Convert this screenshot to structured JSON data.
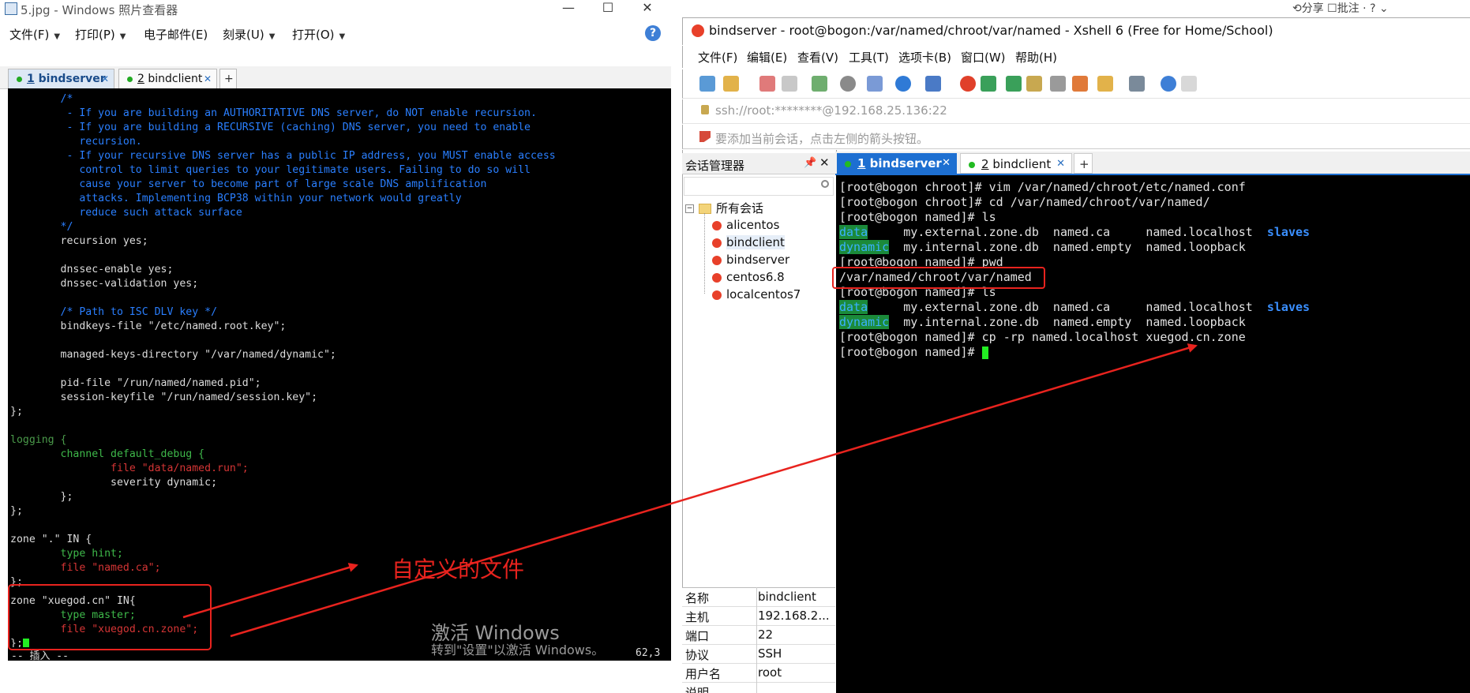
{
  "left_window": {
    "title": "5.jpg - Windows 照片查看器",
    "controls": [
      "—",
      "☐",
      "✕"
    ],
    "menu": [
      {
        "label": "文件(F)",
        "has_dropdown": true
      },
      {
        "label": "打印(P)",
        "has_dropdown": true
      },
      {
        "label": "电子邮件(E)",
        "has_dropdown": false
      },
      {
        "label": "刻录(U)",
        "has_dropdown": true
      },
      {
        "label": "打开(O)",
        "has_dropdown": true
      }
    ],
    "help_label": "?",
    "tabs": [
      {
        "num": "1",
        "name": "bindserver",
        "close": "✕"
      },
      {
        "num": "2",
        "name": "bindclient",
        "close": "✕"
      }
    ],
    "new_tab": "+",
    "terminal": {
      "lines": [
        "        /*",
        "         - If you are building an AUTHORITATIVE DNS server, do NOT enable recursion.",
        "         - If you are building a RECURSIVE (caching) DNS server, you need to enable",
        "           recursion.",
        "         - If your recursive DNS server has a public IP address, you MUST enable access",
        "           control to limit queries to your legitimate users. Failing to do so will",
        "           cause your server to become part of large scale DNS amplification",
        "           attacks. Implementing BCP38 within your network would greatly",
        "           reduce such attack surface",
        "        */",
        "        recursion yes;",
        "",
        "        dnssec-enable yes;",
        "        dnssec-validation yes;",
        "",
        "        /* Path to ISC DLV key */",
        "        bindkeys-file \"/etc/named.root.key\";",
        "",
        "        managed-keys-directory \"/var/named/dynamic\";",
        "",
        "        pid-file \"/run/named/named.pid\";",
        "        session-keyfile \"/run/named/session.key\";",
        "};",
        "",
        "logging {",
        "        channel default_debug {",
        "                file \"data/named.run\";",
        "                severity dynamic;",
        "        };",
        "};",
        "",
        "zone \".\" IN {",
        "        type hint;",
        "        file \"named.ca\";",
        "};",
        "",
        "zone \"xuegod.cn\" IN{",
        "        type master;",
        "        file \"xuegod.cn.zone\";",
        "};"
      ],
      "status_left": "-- 插入 --",
      "status_right": "62,3"
    },
    "watermark_title": "激活 Windows",
    "watermark_sub": "转到\"设置\"以激活 Windows。",
    "annotation_text": "自定义的文件"
  },
  "right_window": {
    "bg_controls": "⟲分享  ☐批注 ·   ?   ⌄",
    "title": "bindserver - root@bogon:/var/named/chroot/var/named - Xshell 6 (Free for Home/School)",
    "menu": [
      "文件(F)",
      "编辑(E)",
      "查看(V)",
      "工具(T)",
      "选项卡(B)",
      "窗口(W)",
      "帮助(H)"
    ],
    "address": "ssh://root:********@192.168.25.136:22",
    "hint": "要添加当前会话，点击左侧的箭头按钮。",
    "session_manager": {
      "title": "会话管理器",
      "pin": "📌",
      "close": "✕",
      "root": "所有会话",
      "sessions": [
        "alicentos",
        "bindclient",
        "bindserver",
        "centos6.8",
        "localcentos7"
      ],
      "selected": "bindclient",
      "properties": [
        {
          "key": "名称",
          "value": "bindclient"
        },
        {
          "key": "主机",
          "value": "192.168.2..."
        },
        {
          "key": "端口",
          "value": "22"
        },
        {
          "key": "协议",
          "value": "SSH"
        },
        {
          "key": "用户名",
          "value": "root"
        },
        {
          "key": "说明",
          "value": ""
        }
      ]
    },
    "tabs": [
      {
        "num": "1",
        "name": "bindserver",
        "close": "✕",
        "active": true
      },
      {
        "num": "2",
        "name": "bindclient",
        "close": "✕",
        "active": false
      }
    ],
    "new_tab": "+",
    "terminal": {
      "cmd1": "[root@bogon chroot]# vim /var/named/chroot/etc/named.conf",
      "cmd2": "[root@bogon chroot]# cd /var/named/chroot/var/named/",
      "cmd3": "[root@bogon named]# ls",
      "ls_row1": {
        "c1": "data",
        "c2": "     my.external.zone.db  named.ca     named.localhost  ",
        "c3": "slaves"
      },
      "ls_row2": {
        "c1": "dynamic",
        "c2": "  my.internal.zone.db  named.empty  named.loopback"
      },
      "cmd4": "[root@bogon named]# pwd",
      "pwd_out": "/var/named/chroot/var/named",
      "cmd5": "[root@bogon named]# ls",
      "cmd6": "[root@bogon named]# cp -rp named.localhost xuegod.cn.zone",
      "prompt": "[root@bogon named]# "
    }
  }
}
